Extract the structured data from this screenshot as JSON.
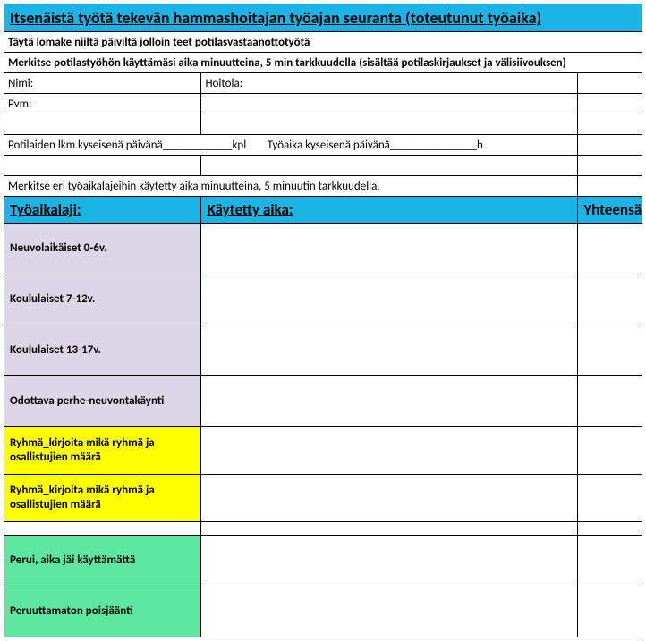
{
  "title": "Itsenäistä työtä tekevän hammashoitajan  työajan seuranta (toteutunut työaika)",
  "instr1": "Täytä lomake niiltä päiviltä jolloin teet potilasvastaanottotyötä",
  "instr2": "Merkitse potilastyöhön käyttämäsi aika minuutteina, 5 min tarkkuudella (sisältää potilaskirjaukset ja välisiivouksen)",
  "fields": {
    "nimi": "Nimi:",
    "hoitola": "Hoitola:",
    "pvm": "Pvm:"
  },
  "counts_line": "Potilaiden lkm kyseisenä päivänä____________kpl        Työaika kyseisenä päivänä_______________h",
  "instr3": "Merkitse eri työaikalajeihin käytetty aika minuutteina, 5 minuutin tarkkuudella.",
  "headers": {
    "col1": "Työaikalaji:",
    "col2": "Käytetty aika:",
    "col3": "Yhteensä"
  },
  "cats": {
    "lav": [
      "Neuvolaikäiset 0-6v.",
      "Koululaiset 7-12v.",
      "Koululaiset 13-17v.",
      "Odottava perhe-neuvontakäynti"
    ],
    "yel": [
      "Ryhmä_kirjoita mikä ryhmä ja osallistujien määrä",
      "Ryhmä_kirjoita mikä ryhmä ja osallistujien määrä"
    ],
    "grn": [
      "Perui, aika jäi käyttämättä",
      "Peruuttamaton poisjäänti"
    ]
  }
}
